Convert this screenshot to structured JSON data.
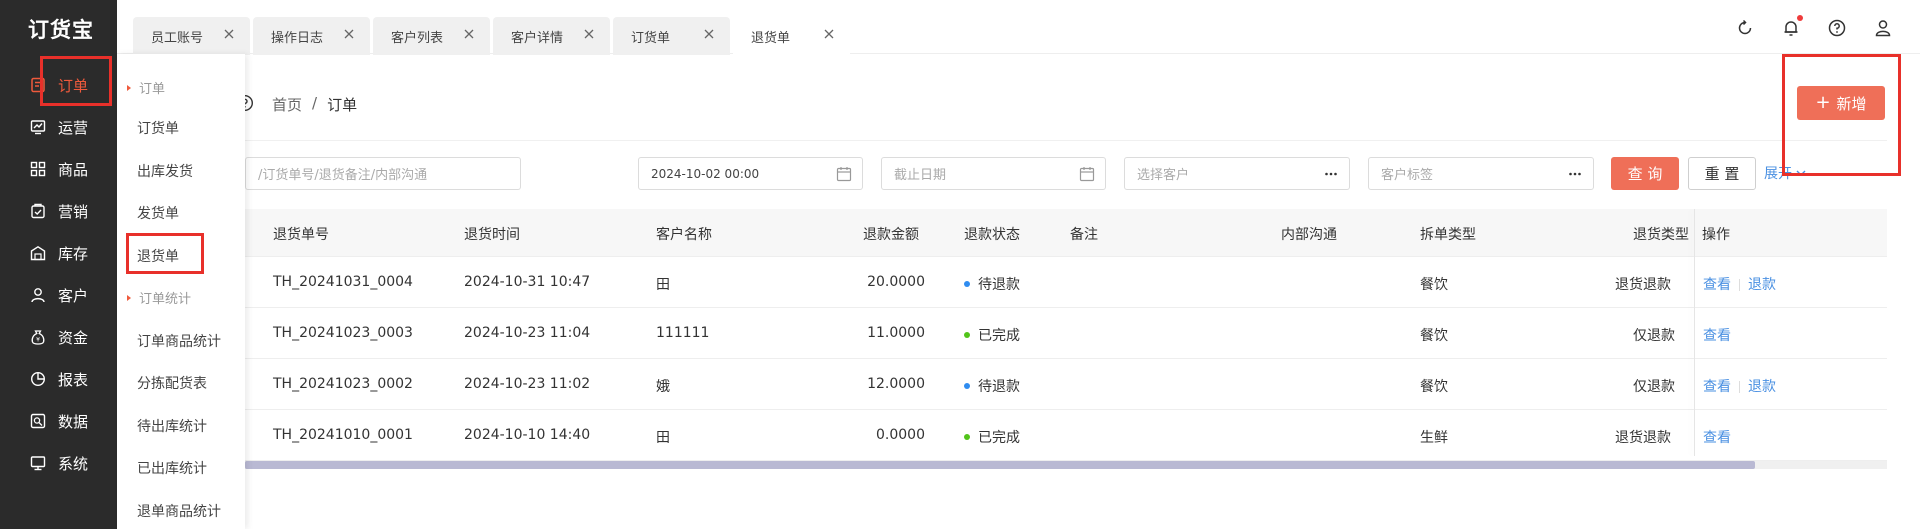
{
  "app": {
    "logo": "订货宝"
  },
  "sidebar": {
    "items": [
      {
        "label": "订单",
        "icon": "order-icon",
        "active": true
      },
      {
        "label": "运营",
        "icon": "operation-icon"
      },
      {
        "label": "商品",
        "icon": "grid-icon"
      },
      {
        "label": "营销",
        "icon": "marketing-icon"
      },
      {
        "label": "库存",
        "icon": "warehouse-icon"
      },
      {
        "label": "客户",
        "icon": "user-icon"
      },
      {
        "label": "资金",
        "icon": "money-bag-icon"
      },
      {
        "label": "报表",
        "icon": "pie-chart-icon"
      },
      {
        "label": "数据",
        "icon": "data-icon"
      },
      {
        "label": "系统",
        "icon": "monitor-icon"
      }
    ]
  },
  "submenu": {
    "group1": "订单",
    "items1": [
      "订货单",
      "出库发货",
      "发货单",
      "退货单"
    ],
    "group2": "订单统计",
    "items2": [
      "订单商品统计",
      "分拣配货表",
      "待出库统计",
      "已出库统计",
      "退单商品统计"
    ]
  },
  "tabs": [
    {
      "label": "员工账号"
    },
    {
      "label": "操作日志"
    },
    {
      "label": "客户列表"
    },
    {
      "label": "客户详情"
    },
    {
      "label": "订货单"
    },
    {
      "label": "退货单",
      "active": true
    }
  ],
  "breadcrumb": {
    "home": "首页",
    "sep": "/",
    "current": "订单"
  },
  "toolbar": {
    "add_label": "新增"
  },
  "filters": {
    "keyword_placeholder": "/订货单号/退货备注/内部沟通",
    "start_date": "2024-10-02 00:00",
    "end_date_placeholder": "截止日期",
    "customer_placeholder": "选择客户",
    "tag_placeholder": "客户标签",
    "query_label": "查 询",
    "reset_label": "重 置",
    "expand_label": "展开"
  },
  "table": {
    "headers": [
      "退货单号",
      "退货时间",
      "客户名称",
      "退款金额",
      "退款状态",
      "备注",
      "内部沟通",
      "拆单类型",
      "退货类型",
      "操作"
    ],
    "rows": [
      {
        "no": "TH_20241031_0004",
        "time": "2024-10-31 10:47",
        "customer": "田",
        "amount": "20.0000",
        "status": "待退款",
        "note": "",
        "internal": "",
        "split": "餐饮",
        "type": "退货退款",
        "ops": [
          "查看",
          "退款"
        ]
      },
      {
        "no": "TH_20241023_0003",
        "time": "2024-10-23 11:04",
        "customer": "111111",
        "amount": "11.0000",
        "status": "已完成",
        "note": "",
        "internal": "",
        "split": "餐饮",
        "type": "仅退款",
        "ops": [
          "查看"
        ]
      },
      {
        "no": "TH_20241023_0002",
        "time": "2024-10-23 11:02",
        "customer": "娥",
        "amount": "12.0000",
        "status": "待退款",
        "note": "",
        "internal": "",
        "split": "餐饮",
        "type": "仅退款",
        "ops": [
          "查看",
          "退款"
        ]
      },
      {
        "no": "TH_20241010_0001",
        "time": "2024-10-10 14:40",
        "customer": "田",
        "amount": "0.0000",
        "status": "已完成",
        "note": "",
        "internal": "",
        "split": "生鲜",
        "type": "退货退款",
        "ops": [
          "查看"
        ]
      }
    ]
  },
  "colors": {
    "accent": "#ef6f58",
    "active_nav": "#ef5a3c",
    "link": "#4a90e2",
    "pending": "#2f8cf0",
    "done": "#52c41a",
    "annotation": "#e8302a"
  }
}
